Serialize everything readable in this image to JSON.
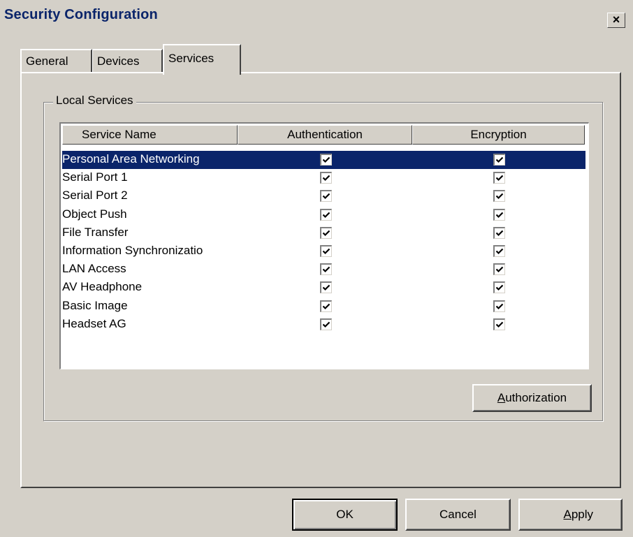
{
  "window": {
    "title": "Security Configuration",
    "close_glyph": "×"
  },
  "tabs": [
    {
      "label": "General",
      "active": false
    },
    {
      "label": "Devices",
      "active": false
    },
    {
      "label": "Services",
      "active": true
    }
  ],
  "group": {
    "label": "Local Services"
  },
  "list": {
    "columns": [
      "Service Name",
      "Authentication",
      "Encryption"
    ],
    "rows": [
      {
        "name": "Personal Area Networking",
        "authentication": true,
        "encryption": true,
        "selected": true
      },
      {
        "name": "Serial Port 1",
        "authentication": true,
        "encryption": true,
        "selected": false
      },
      {
        "name": "Serial Port 2",
        "authentication": true,
        "encryption": true,
        "selected": false
      },
      {
        "name": "Object Push",
        "authentication": true,
        "encryption": true,
        "selected": false
      },
      {
        "name": "File Transfer",
        "authentication": true,
        "encryption": true,
        "selected": false
      },
      {
        "name": "Information Synchronizatio",
        "authentication": true,
        "encryption": true,
        "selected": false
      },
      {
        "name": "LAN Access",
        "authentication": true,
        "encryption": true,
        "selected": false
      },
      {
        "name": "AV Headphone",
        "authentication": true,
        "encryption": true,
        "selected": false
      },
      {
        "name": "Basic Image",
        "authentication": true,
        "encryption": true,
        "selected": false
      },
      {
        "name": "Headset AG",
        "authentication": true,
        "encryption": true,
        "selected": false
      }
    ]
  },
  "buttons": {
    "authorization": {
      "accel": "A",
      "rest": "uthorization"
    },
    "ok": "OK",
    "cancel": "Cancel",
    "apply": {
      "accel": "A",
      "rest": "pply"
    }
  },
  "colors": {
    "face": "#d4d0c8",
    "selection": "#0a246a",
    "title_text": "#0a246a"
  },
  "icons": {
    "checkbox": "checkmark-icon",
    "close": "close-icon"
  }
}
